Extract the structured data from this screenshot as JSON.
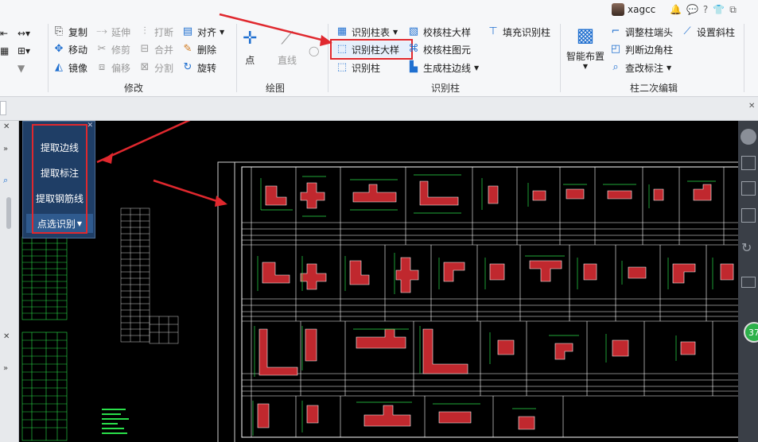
{
  "user": {
    "name": "xagcc"
  },
  "ribbon": {
    "edit": {
      "copy": "复制",
      "move": "移动",
      "mirror": "镜像",
      "extend": "延伸",
      "trim": "修剪",
      "offset": "偏移",
      "break": "打断",
      "merge": "合并",
      "split": "分割",
      "align": "对齐",
      "delete": "删除",
      "rotate": "旋转",
      "group_label": "修改"
    },
    "draw": {
      "point": "点",
      "line": "直线",
      "group_label": "绘图"
    },
    "identify": {
      "table": "识别柱表",
      "detail": "识别柱大样",
      "column": "识别柱",
      "check_detail": "校核柱大样",
      "check_elem": "校核柱图元",
      "gen_edge": "生成柱边线",
      "fill": "填充识别柱",
      "group_label": "识别柱"
    },
    "secondary": {
      "smart": "智能布置",
      "adjust_end": "调整柱端头",
      "corner": "判断边角柱",
      "check_label": "查改标注",
      "set_slope": "设置斜柱",
      "group_label": "柱二次编辑"
    }
  },
  "float_panel": {
    "items": [
      "提取边线",
      "提取标注",
      "提取钢筋线",
      "点选识别"
    ]
  },
  "badge": {
    "value": "37"
  },
  "colors": {
    "accent": "#e0282e",
    "panel": "#1f3e66",
    "canvas": "#000000"
  }
}
